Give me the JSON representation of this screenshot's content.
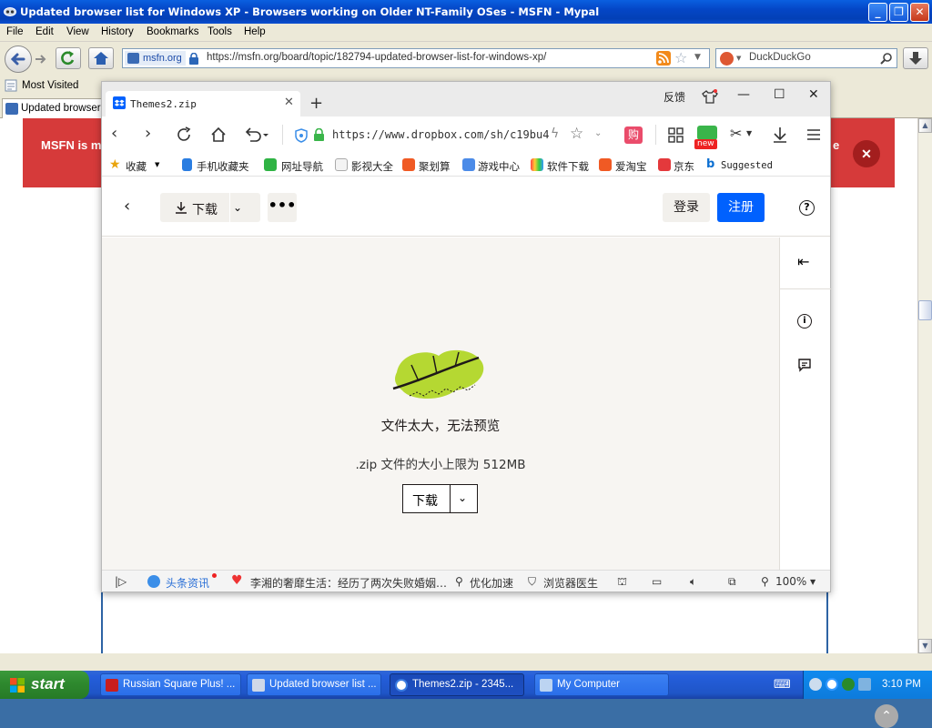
{
  "mypal": {
    "title": "Updated browser list for Windows XP - Browsers working on Older NT-Family OSes - MSFN - Mypal",
    "menu": [
      "File",
      "Edit",
      "View",
      "History",
      "Bookmarks",
      "Tools",
      "Help"
    ],
    "site_label": "msfn.org",
    "url": "https://msfn.org/board/topic/182794-updated-browser-list-for-windows-xp/",
    "search_placeholder": "DuckDuckGo",
    "bookmark": "Most Visited",
    "tab_title": "Updated browser li"
  },
  "page": {
    "banner_left": "MSFN is m",
    "banner_right": "e"
  },
  "popup": {
    "tab_title": "Themes2.zip",
    "feedback": "反馈",
    "url": "https://www.dropbox.com/sh/c19bu4",
    "new_badge": "new",
    "favorites": [
      "收藏",
      "手机收藏夹",
      "网址导航",
      "影视大全",
      "聚划算",
      "游戏中心",
      "软件下载",
      "爱淘宝",
      "京东",
      "Suggested"
    ],
    "status": {
      "news": "头条资讯",
      "headline": "李湘的奢靡生活：经历了两次失败婚姻…",
      "optimize": "优化加速",
      "doctor": "浏览器医生",
      "zoom": "100%"
    }
  },
  "dropbox": {
    "download": "下载",
    "login": "登录",
    "signup": "注册",
    "message": "文件太大，无法预览",
    "limit": ".zip 文件的大小上限为 512MB",
    "download2": "下载"
  },
  "taskbar": {
    "start": "start",
    "tasks": [
      {
        "label": "Russian Square Plus! ..."
      },
      {
        "label": "Updated browser list ..."
      },
      {
        "label": "Themes2.zip - 2345..."
      },
      {
        "label": "My Computer"
      }
    ],
    "clock": "3:10 PM"
  }
}
